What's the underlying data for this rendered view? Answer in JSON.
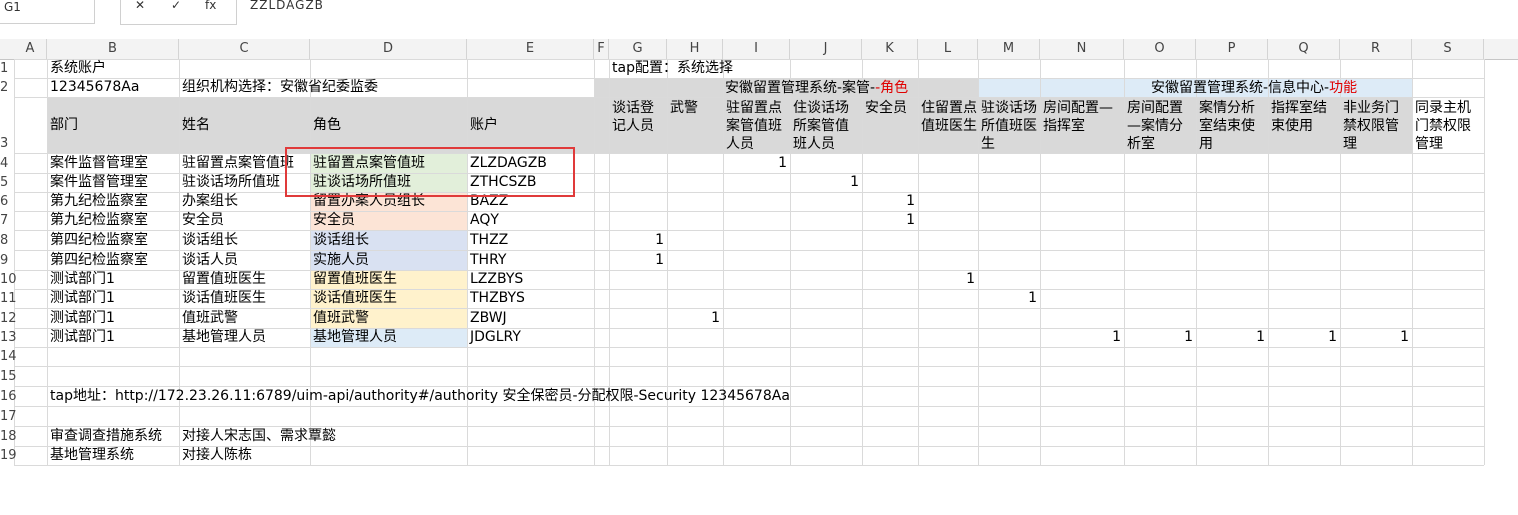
{
  "formula_bar": {
    "cell_ref": "G1",
    "formula": "ZZLDAGZB"
  },
  "columns": [
    "A",
    "B",
    "C",
    "D",
    "E",
    "F",
    "G",
    "H",
    "I",
    "J",
    "K",
    "L",
    "M",
    "N",
    "O",
    "P",
    "Q",
    "R",
    "S"
  ],
  "rows": [
    "1",
    "2",
    "3",
    "4",
    "5",
    "6",
    "7",
    "8",
    "9",
    "10",
    "11",
    "12",
    "13",
    "14",
    "15",
    "16",
    "17",
    "18",
    "19"
  ],
  "cells": {
    "b1": "系统账户",
    "b2": "12345678Aa",
    "c2": "组织机构选择：安徽省纪委监委",
    "g1": "tap配置：系统选择",
    "group1_title": "安徽留置管理系统-案管-",
    "group1_title_red": "-角色",
    "group2_title": "安徽留置管理系统-信息中心-",
    "group2_title_red": "功能",
    "hdr_dept": "部门",
    "hdr_name": "姓名",
    "hdr_role": "角色",
    "hdr_account": "账户",
    "perm_headers": [
      "谈话登记人员",
      "武警",
      "驻留置点案管值班人员",
      "住谈话场所案管值班人员",
      "安全员",
      "住留置点值班医生",
      "驻谈话场所值班医生",
      "房间配置—指挥室",
      "房间配置—案情分析室",
      "案情分析室结束使用",
      "指挥室结束使用",
      "非业务门禁权限管理",
      "同录主机门禁权限管理"
    ],
    "data_rows": [
      {
        "dept": "案件监督管理室",
        "name": "驻留置点案管值班",
        "role": "驻留置点案管值班",
        "account": "ZLZDAGZB",
        "role_color": "#e2efda"
      },
      {
        "dept": "案件监督管理室",
        "name": "驻谈话场所值班",
        "role": "驻谈话场所值班",
        "account": "ZTHCSZB",
        "role_color": "#e2efda"
      },
      {
        "dept": "第九纪检监察室",
        "name": "办案组长",
        "role": "留置办案人员组长",
        "account": "BAZZ",
        "role_color": "#fce4d6"
      },
      {
        "dept": "第九纪检监察室",
        "name": "安全员",
        "role": "安全员",
        "account": "AQY",
        "role_color": "#fce4d6"
      },
      {
        "dept": "第四纪检监察室",
        "name": "谈话组长",
        "role": "谈话组长",
        "account": "THZZ",
        "role_color": "#d9e1f2"
      },
      {
        "dept": "第四纪检监察室",
        "name": "谈话人员",
        "role": "实施人员",
        "account": "THRY",
        "role_color": "#d9e1f2"
      },
      {
        "dept": "测试部门1",
        "name": "留置值班医生",
        "role": "留置值班医生",
        "account": "LZZBYS",
        "role_color": "#fff2cc"
      },
      {
        "dept": "测试部门1",
        "name": "谈话值班医生",
        "role": "谈话值班医生",
        "account": "THZBYS",
        "role_color": "#fff2cc"
      },
      {
        "dept": "测试部门1",
        "name": "值班武警",
        "role": "值班武警",
        "account": "ZBWJ",
        "role_color": "#fff2cc"
      },
      {
        "dept": "测试部门1",
        "name": "基地管理人员",
        "role": "基地管理人员",
        "account": "JDGLRY",
        "role_color": "#ddebf7"
      }
    ],
    "matrix_ones": [
      {
        "row": 0,
        "col": "I",
        "value": "1"
      },
      {
        "row": 1,
        "col": "J",
        "value": "1"
      },
      {
        "row": 2,
        "col": "K",
        "value": "1"
      },
      {
        "row": 3,
        "col": "K",
        "value": "1"
      },
      {
        "row": 4,
        "col": "G",
        "value": "1"
      },
      {
        "row": 5,
        "col": "G",
        "value": "1"
      },
      {
        "row": 6,
        "col": "L",
        "value": "1"
      },
      {
        "row": 7,
        "col": "M",
        "value": "1"
      },
      {
        "row": 8,
        "col": "H",
        "value": "1"
      },
      {
        "row": 9,
        "col": "N",
        "value": "1"
      },
      {
        "row": 9,
        "col": "O",
        "value": "1"
      },
      {
        "row": 9,
        "col": "P",
        "value": "1"
      },
      {
        "row": 9,
        "col": "Q",
        "value": "1"
      },
      {
        "row": 9,
        "col": "R",
        "value": "1"
      }
    ],
    "b16": "tap地址：http://172.23.26.11:6789/uim-api/authority#/authority   安全保密员-分配权限-Security  12345678Aa",
    "b18": "审查调查措施系统",
    "c18": "对接人宋志国、需求覃懿",
    "b19": "基地管理系统",
    "c19": "对接人陈栋"
  },
  "colors": {
    "group_header_gray": "#d9d9d9",
    "group_header_blue": "#ddebf7",
    "header_gray": "#d9d9d9",
    "highlight_red": "#e03a3a"
  }
}
